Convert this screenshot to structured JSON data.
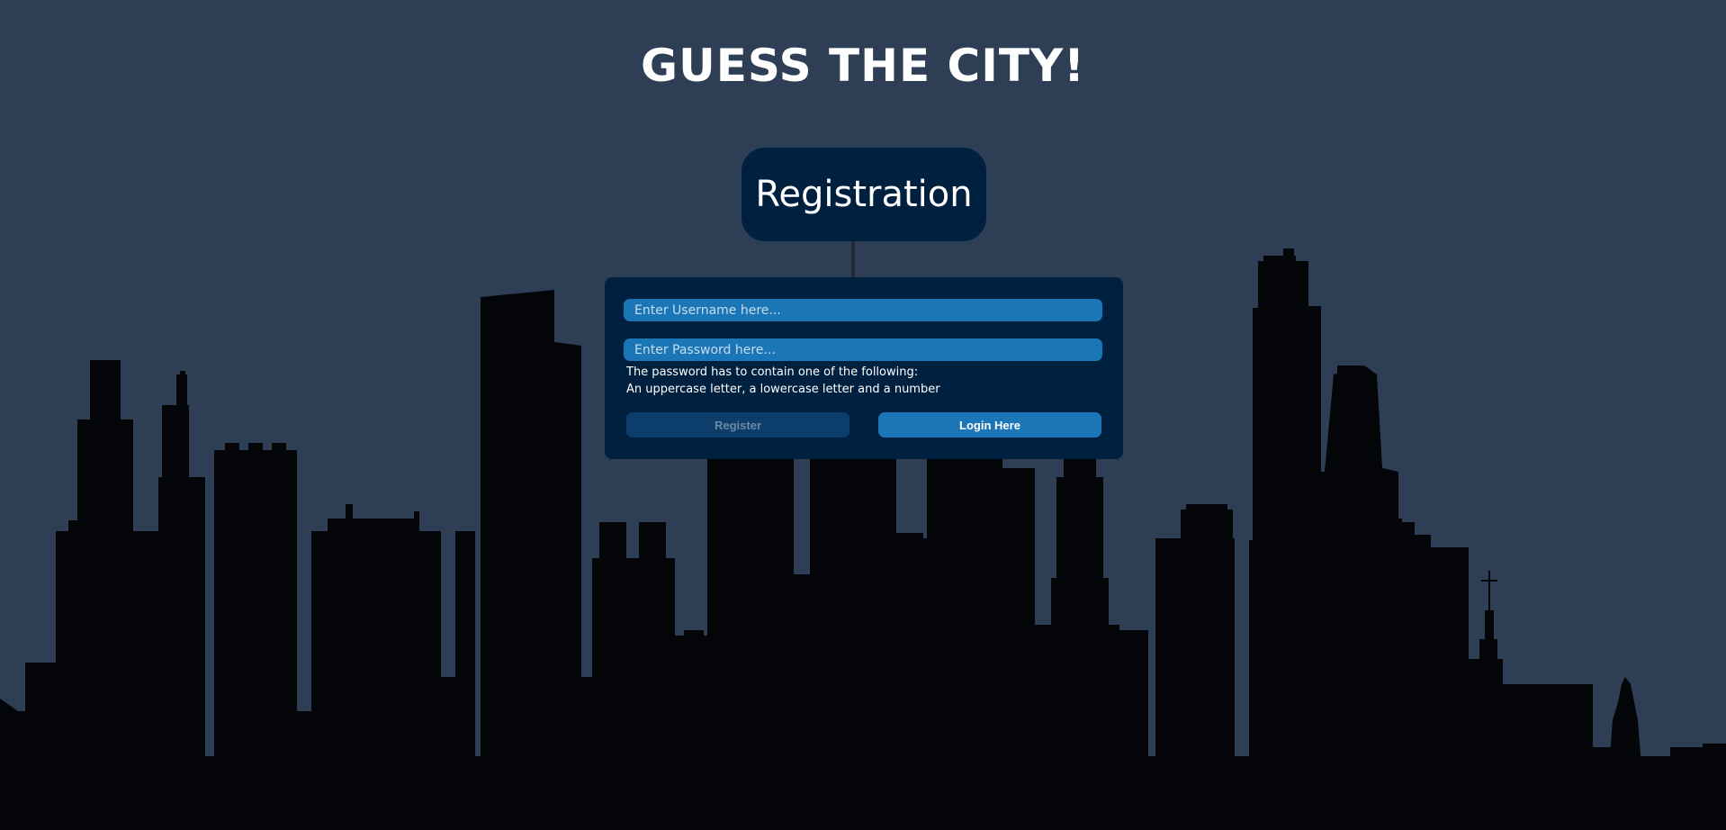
{
  "page": {
    "title": "GUESS THE CITY!",
    "background_color": "#2e3f55",
    "skyline_color": "#030508"
  },
  "registration": {
    "heading": "Registration",
    "username": {
      "value": "",
      "placeholder": "Enter Username here..."
    },
    "password": {
      "value": "",
      "placeholder": "Enter Password here..."
    },
    "password_hint_line1": "The password has to contain one of the following:",
    "password_hint_line2": "An uppercase letter, a lowercase letter and a number",
    "register_label": "Register",
    "register_disabled": true,
    "login_label": "Login Here"
  },
  "colors": {
    "panel": "#00203f",
    "input": "#1b76b8",
    "button_primary": "#1b76b8",
    "button_disabled": "#0d3e6b"
  }
}
